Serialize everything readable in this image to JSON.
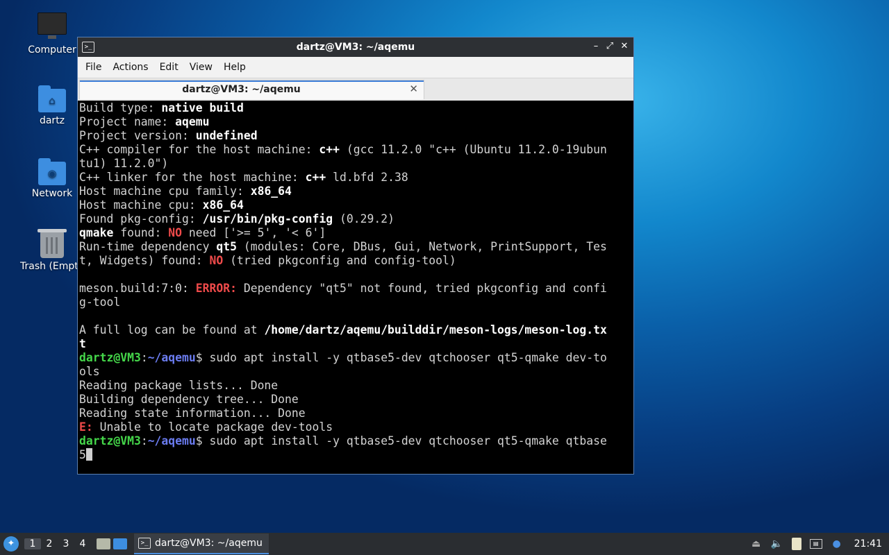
{
  "desktop": {
    "icons": [
      {
        "label": "Computer",
        "icon": "computer-icon"
      },
      {
        "label": "dartz",
        "icon": "home-folder-icon"
      },
      {
        "label": "Network",
        "icon": "network-folder-icon"
      },
      {
        "label": "Trash (Empt",
        "icon": "trash-icon"
      }
    ]
  },
  "window": {
    "title": "dartz@VM3: ~/aqemu",
    "controls": {
      "minimize": "–",
      "maximize": "⤢",
      "close": "✕"
    },
    "menu": [
      "File",
      "Actions",
      "Edit",
      "View",
      "Help"
    ],
    "tab": {
      "label": "dartz@VM3: ~/aqemu",
      "close": "✕"
    }
  },
  "terminal": {
    "l1_a": "Build type: ",
    "l1_b": "native build",
    "l2_a": "Project name: ",
    "l2_b": "aqemu",
    "l3_a": "Project version: ",
    "l3_b": "undefined",
    "l4_a": "C++ compiler for the host machine: ",
    "l4_b": "c++",
    "l4_c": " (gcc 11.2.0 \"c++ (Ubuntu 11.2.0-19ubun",
    "l5": "tu1) 11.2.0\")",
    "l6_a": "C++ linker for the host machine: ",
    "l6_b": "c++",
    "l6_c": " ld.bfd 2.38",
    "l7_a": "Host machine cpu family: ",
    "l7_b": "x86_64",
    "l8_a": "Host machine cpu: ",
    "l8_b": "x86_64",
    "l9_a": "Found pkg-config: ",
    "l9_b": "/usr/bin/pkg-config",
    "l9_c": " (0.29.2)",
    "l10_a": "qmake",
    "l10_b": " found: ",
    "l10_c": "NO",
    "l10_d": " need ['>= 5', '< 6']",
    "l11_a": "Run-time dependency ",
    "l11_b": "qt5",
    "l11_c": " (modules: Core, DBus, Gui, Network, PrintSupport, Tes",
    "l12_a": "t, Widgets) found: ",
    "l12_b": "NO",
    "l12_c": " (tried pkgconfig and config-tool)",
    "l14_a": "meson.build:7:0: ",
    "l14_b": "ERROR:",
    "l14_c": " Dependency \"qt5\" not found, tried pkgconfig and confi",
    "l15": "g-tool",
    "l17_a": "A full log can be found at ",
    "l17_b": "/home/dartz/aqemu/builddir/meson-logs/meson-log.tx",
    "l18": "t",
    "prompt_user": "dartz@VM3",
    "prompt_sep": ":",
    "prompt_path": "~/aqemu",
    "prompt_end": "$",
    "cmd1": " sudo apt install -y qtbase5-dev qtchooser qt5-qmake dev-to",
    "cmd1_cont": "ols",
    "o1": "Reading package lists... Done",
    "o2": "Building dependency tree... Done",
    "o3": "Reading state information... Done",
    "e_a": "E:",
    "e_b": " Unable to locate package dev-tools",
    "cmd2": " sudo apt install -y qtbase5-dev qtchooser qt5-qmake qtbase",
    "cmd2_cont": "5"
  },
  "taskbar": {
    "workspaces": [
      "1",
      "2",
      "3",
      "4"
    ],
    "active_workspace": "1",
    "task_label": "dartz@VM3: ~/aqemu",
    "clock": "21:41"
  }
}
